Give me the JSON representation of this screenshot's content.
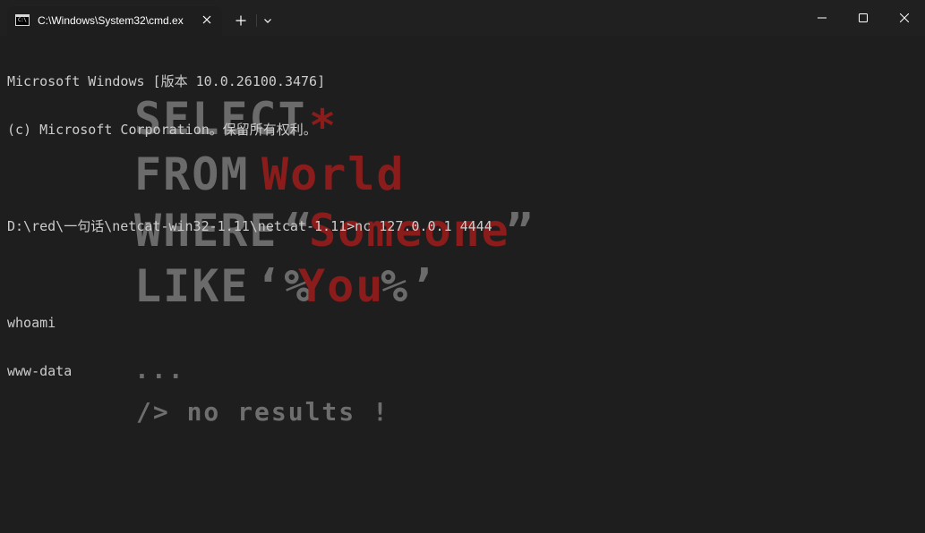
{
  "window": {
    "tab_title": "C:\\Windows\\System32\\cmd.ex",
    "tab_icon_glyph": "C:\\",
    "icons": {
      "tab": "cmd-icon",
      "close_tab": "close-icon",
      "new_tab": "plus-icon",
      "dropdown": "chevron-down-icon",
      "minimize": "minimize-icon",
      "maximize": "maximize-icon",
      "close": "close-icon"
    }
  },
  "terminal": {
    "lines": [
      "Microsoft Windows [版本 10.0.26100.3476]",
      "(c) Microsoft Corporation。保留所有权利。",
      "",
      "D:\\red\\一句话\\netcat-win32-1.11\\netcat-1.11>nc 127.0.0.1 4444",
      "",
      "whoami",
      "www-data"
    ]
  },
  "background_art": {
    "line1_keyword": "SELECT",
    "line1_value": "*",
    "line2_keyword": "FROM",
    "line2_value": "World",
    "line3_keyword": "WHERE",
    "line3_open_quote": "“",
    "line3_value": "Someone",
    "line3_close_quote": "”",
    "line4_keyword": "LIKE",
    "line4_open": "‘%",
    "line4_value": "You",
    "line4_close": "%’",
    "ellipsis": "...",
    "footer": "/> no results !",
    "colors": {
      "keyword": "#6b6b6b",
      "value": "#8a1c1c",
      "footer": "#6e6e6e"
    }
  }
}
